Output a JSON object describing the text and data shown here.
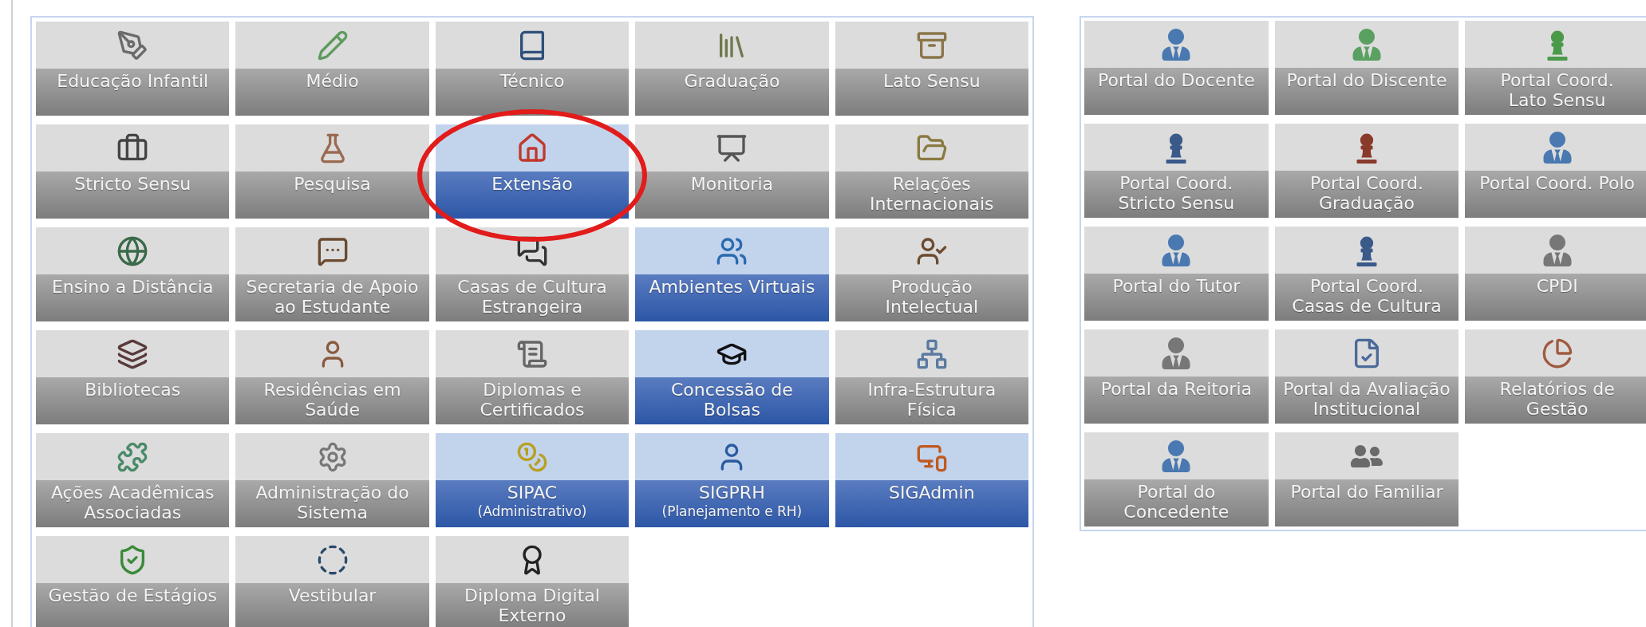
{
  "modules": [
    {
      "label": "Educação Infantil",
      "highlighted": false
    },
    {
      "label": "Médio",
      "highlighted": false
    },
    {
      "label": "Técnico",
      "highlighted": false
    },
    {
      "label": "Graduação",
      "highlighted": false
    },
    {
      "label": "Lato Sensu",
      "highlighted": false
    },
    {
      "label": "Stricto Sensu",
      "highlighted": false
    },
    {
      "label": "Pesquisa",
      "highlighted": false
    },
    {
      "label": "Extensão",
      "highlighted": true
    },
    {
      "label": "Monitoria",
      "highlighted": false
    },
    {
      "label": "Relações\nInternacionais",
      "highlighted": false
    },
    {
      "label": "Ensino a Distância",
      "highlighted": false
    },
    {
      "label": "Secretaria de Apoio\nao Estudante",
      "highlighted": false
    },
    {
      "label": "Casas de Cultura\nEstrangeira",
      "highlighted": false
    },
    {
      "label": "Ambientes Virtuais",
      "highlighted": true
    },
    {
      "label": "Produção\nIntelectual",
      "highlighted": false
    },
    {
      "label": "Bibliotecas",
      "highlighted": false
    },
    {
      "label": "Residências em\nSaúde",
      "highlighted": false
    },
    {
      "label": "Diplomas e\nCertificados",
      "highlighted": false
    },
    {
      "label": "Concessão de\nBolsas",
      "highlighted": true
    },
    {
      "label": "Infra-Estrutura\nFísica",
      "highlighted": false
    },
    {
      "label": "Ações Acadêmicas\nAssociadas",
      "highlighted": false
    },
    {
      "label": "Administração do\nSistema",
      "highlighted": false
    },
    {
      "label": "SIPAC",
      "sublabel": "(Administrativo)",
      "highlighted": true
    },
    {
      "label": "SIGPRH",
      "sublabel": "(Planejamento e RH)",
      "highlighted": true
    },
    {
      "label": "SIGAdmin",
      "highlighted": true
    },
    {
      "label": "Gestão de Estágios",
      "highlighted": false
    },
    {
      "label": "Vestibular",
      "highlighted": false
    },
    {
      "label": "Diploma Digital\nExterno",
      "highlighted": false
    }
  ],
  "portals": [
    {
      "label": "Portal do Docente"
    },
    {
      "label": "Portal do Discente"
    },
    {
      "label": "Portal Coord.\nLato Sensu"
    },
    {
      "label": "Portal Coord.\nStricto Sensu"
    },
    {
      "label": "Portal Coord.\nGraduação"
    },
    {
      "label": "Portal Coord. Polo"
    },
    {
      "label": "Portal do Tutor"
    },
    {
      "label": "Portal Coord.\nCasas de Cultura"
    },
    {
      "label": "CPDI"
    },
    {
      "label": "Portal da Reitoria"
    },
    {
      "label": "Portal da Avaliação\nInstitucional"
    },
    {
      "label": "Relatórios de\nGestão"
    },
    {
      "label": "Portal do\nConcedente"
    },
    {
      "label": "Portal do Familiar"
    }
  ]
}
